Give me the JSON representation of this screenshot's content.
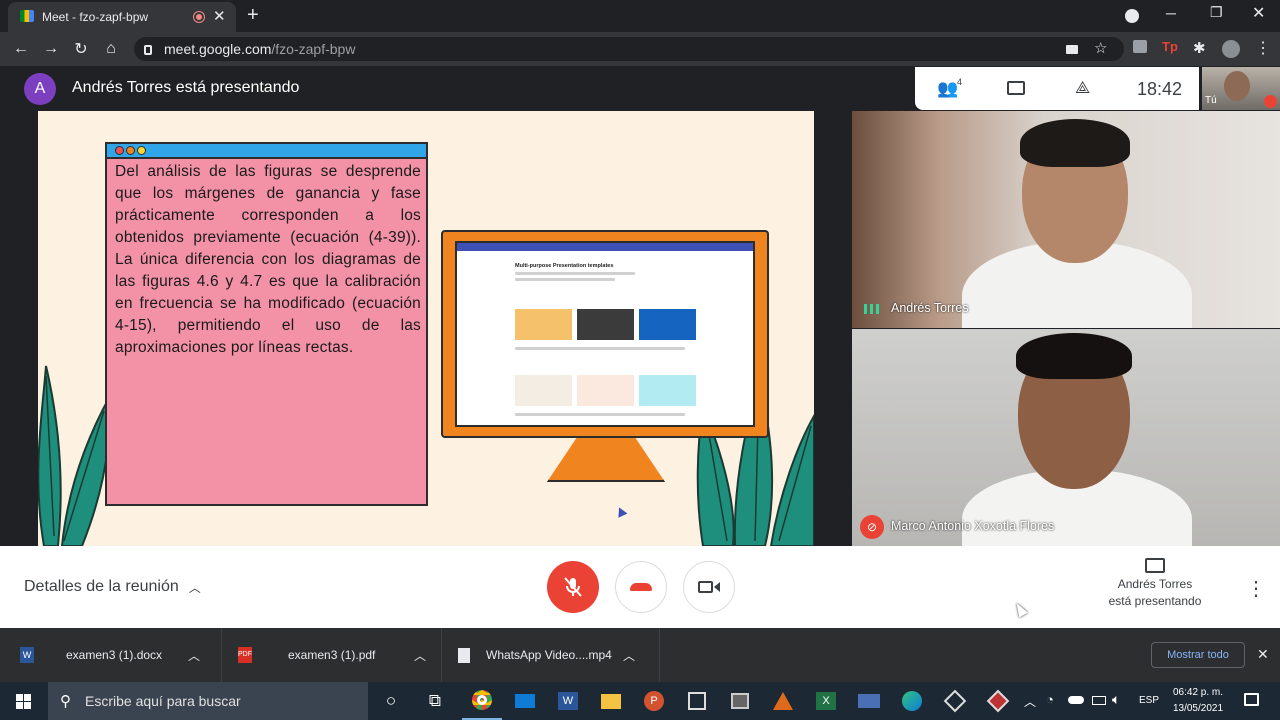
{
  "browser": {
    "tab_title": "Meet - fzo-zapf-bpw",
    "url_domain": "meet.google.com",
    "url_path": "/fzo-zapf-bpw",
    "new_tab_label": "+"
  },
  "meet": {
    "presenter_initial": "A",
    "presenting_banner": "Andrés Torres está presentando",
    "people_count": "4",
    "clock": "18:42",
    "self_label": "Tú",
    "slide_text": "Del análisis de las figuras se desprende que los márgenes de ganancia y fase prácticamente corresponden a los obtenidos previamente (ecuación (4-39)). La única diferencia con los diagramas de las figuras 4.6 y 4.7 es que la calibración en frecuencia se ha modificado (ecuación 4-15), permitiendo el uso de las aproximaciones por líneas rectas.",
    "screen_heading": "Multi-purpose Presentation templates",
    "participants": [
      {
        "name": "Andrés Torres"
      },
      {
        "name": "Marco Antonio Xoxotla Flores"
      }
    ],
    "meeting_details": "Detalles de la reunión",
    "presenting_line1": "Andrés Torres",
    "presenting_line2": "está presentando"
  },
  "downloads": {
    "items": [
      {
        "name": "examen3 (1).docx"
      },
      {
        "name": "examen3 (1).pdf"
      },
      {
        "name": "WhatsApp Video....mp4"
      }
    ],
    "show_all": "Mostrar todo"
  },
  "taskbar": {
    "search_placeholder": "Escribe aquí para buscar",
    "lang": "ESP",
    "time": "06:42 p. m.",
    "date": "13/05/2021"
  },
  "colors": {
    "mic_off_red": "#ea4335",
    "slide_bg": "#fdf1e2",
    "card_pink": "#f391a6",
    "monitor_orange": "#f0841f",
    "leaf_teal": "#1d8f7c"
  }
}
